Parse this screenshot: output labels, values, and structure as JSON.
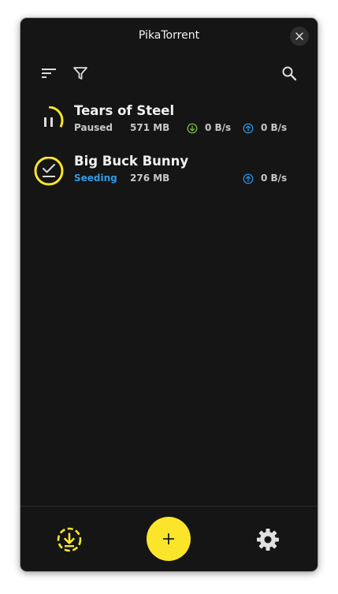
{
  "window": {
    "title": "PikaTorrent"
  },
  "toolbar": {
    "sort_icon": "sort-icon",
    "filter_icon": "filter-icon",
    "search_icon": "search-icon"
  },
  "torrents": [
    {
      "name": "Tears of Steel",
      "status": "Paused",
      "size": "571 MB",
      "download_rate": "0 B/s",
      "upload_rate": "0 B/s",
      "progress": 0.33,
      "status_icon": "pause-icon"
    },
    {
      "name": "Big Buck Bunny",
      "status": "Seeding",
      "size": "276 MB",
      "upload_rate": "0 B/s",
      "progress": 1.0,
      "status_icon": "check-icon"
    }
  ],
  "bottom_bar": {
    "downloads_icon": "download-circle-icon",
    "add_icon": "plus-icon",
    "settings_icon": "gear-icon"
  },
  "colors": {
    "accent": "#fbe52b",
    "seeding": "#2f9ae6",
    "download": "#8bc34a",
    "upload": "#2f9ae6",
    "background": "#151515"
  }
}
